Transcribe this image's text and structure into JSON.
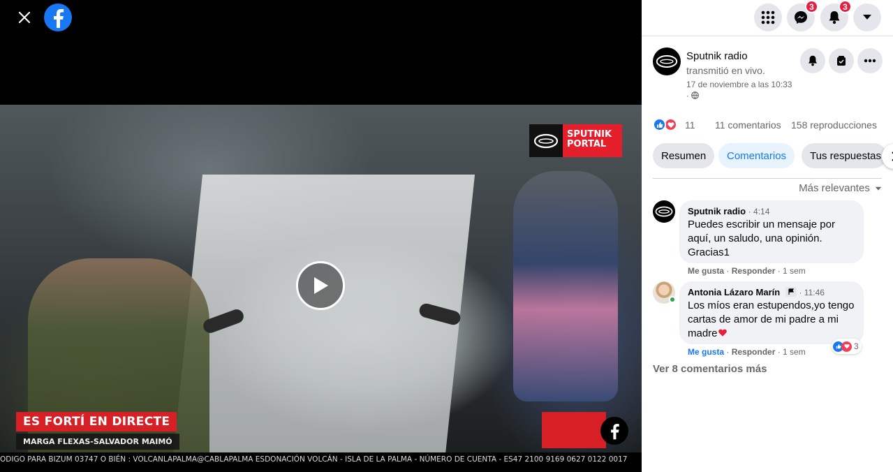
{
  "colors": {
    "fb_blue": "#1877f2",
    "red": "#e41e2b",
    "bubble": "#f0f2f5",
    "muted": "#65676b"
  },
  "video": {
    "close_icon": "close-icon",
    "badge_text_1": "SPUTNIK",
    "badge_text_2": "PORTAL",
    "lower_title": "ES FORTÍ EN DIRECTE",
    "lower_sub": "MARGA FLEXAS-SALVADOR MAIMÓ",
    "ticker": "ODIGO PARA BIZUM 03747 O BIÉN : VOLCANLAPALMA@CABLAPALMA ESDONACIÓN VOLCÁN - ISLA DE LA PALMA - NÚMERO DE CUENTA - ES47 2100 9169 0627 0122 0017",
    "play_icon": "play-icon"
  },
  "topbar": {
    "menu_icon": "grid-icon",
    "messenger_badge": "3",
    "notifications_badge": "3",
    "account_icon": "caret-down-icon"
  },
  "post": {
    "page_name": "Sputnik radio",
    "action": "transmitió en vivo.",
    "date": "17 de noviembre a las 10:33",
    "privacy": "·",
    "reactions_count": "11",
    "comments_count": "11 comentarios",
    "views": "158 reproducciones"
  },
  "tabs": [
    {
      "label": "Resumen",
      "active": false
    },
    {
      "label": "Comentarios",
      "active": true
    },
    {
      "label": "Tus respuestas",
      "active": false
    }
  ],
  "sort_label": "Más relevantes",
  "comments": [
    {
      "author": "Sputnik radio",
      "time": "4:14",
      "text": "Puedes escribir un mensaje por aquí, un saludo, una opinión. Gracias1",
      "like": "Me gusta",
      "reply": "Responder",
      "age": "1 sem"
    },
    {
      "author": "Antonia Lázaro Marín",
      "time": "11:46",
      "text": "Los míos eran estupendos,yo tengo cartas de amor de mi padre a mi madre",
      "like": "Me gusta",
      "reply": "Responder",
      "age": "1 sem",
      "reactions": "3"
    }
  ],
  "more_comments": "Ver 8 comentarios más"
}
